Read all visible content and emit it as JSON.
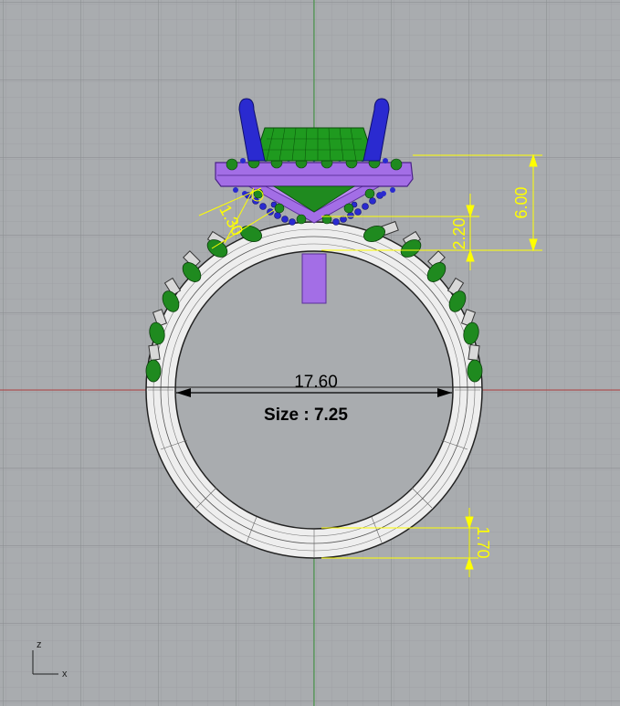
{
  "viewport": {
    "background": "#a9acaf",
    "grid_minor_color": "#9ea1a4",
    "grid_major_color": "#8d9093",
    "x_axis_color": "#b04040",
    "z_axis_color": "#3f9a3f"
  },
  "dimensions": {
    "inner_diameter": "17.60",
    "ring_size": "Size  : 7.25",
    "total_height": "6.00",
    "setting_height": "2.20",
    "band_thickness": "1.70",
    "halo_gap": "1.30"
  },
  "axis_gizmo": {
    "vertical_label": "z",
    "horizontal_label": "x"
  },
  "colors": {
    "dimension_line": "#ffff00",
    "dimension_black": "#000000",
    "gems": "#1f8a1f",
    "prongs": "#2a2ad0",
    "setting": "#a36ee6",
    "band_fill": "#eeeeee",
    "band_outline": "#222222"
  }
}
